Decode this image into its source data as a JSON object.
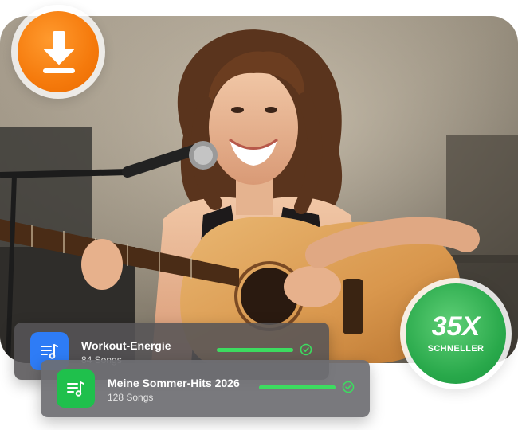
{
  "colors": {
    "download_orange": "#f57a0c",
    "speed_green": "#28a84a",
    "progress_green": "#3ddc60",
    "playlist_blue": "#2e7cf6",
    "playlist_green": "#1fc04c"
  },
  "download_badge": {
    "icon": "download-icon"
  },
  "speed_badge": {
    "value": "35X",
    "label": "SCHNELLER"
  },
  "playlists": [
    {
      "title": "Workout-Energie",
      "subtitle": "84 Songs",
      "icon": "music-list-icon",
      "progress": 1.0,
      "status_icon": "check-circle-icon"
    },
    {
      "title": "Meine Sommer-Hits 2026",
      "subtitle": "128 Songs",
      "icon": "music-list-icon",
      "progress": 1.0,
      "status_icon": "check-circle-icon"
    }
  ]
}
